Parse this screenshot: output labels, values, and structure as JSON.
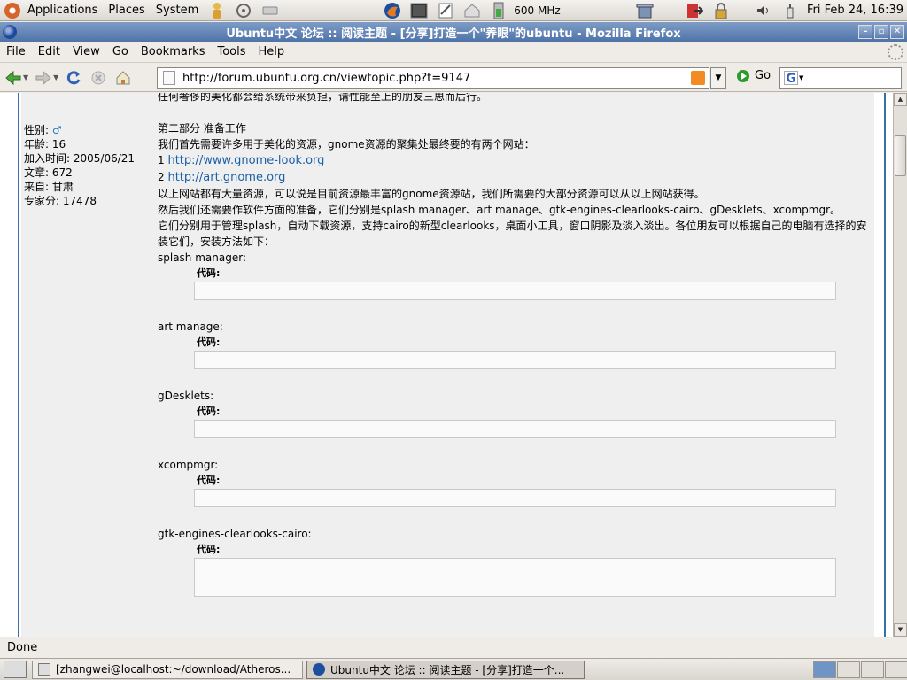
{
  "panel": {
    "menus": [
      "Applications",
      "Places",
      "System"
    ],
    "cpu_freq": "600 MHz",
    "clock": "Fri Feb 24, 16:39"
  },
  "window": {
    "title": "Ubuntu中文 论坛 :: 阅读主题 - [分享]打造一个\"养眼\"的ubuntu - Mozilla Firefox"
  },
  "menubar": {
    "items": [
      "File",
      "Edit",
      "View",
      "Go",
      "Bookmarks",
      "Tools",
      "Help"
    ]
  },
  "navbar": {
    "url": "http://forum.ubuntu.org.cn/viewtopic.php?t=9147",
    "go_label": "Go"
  },
  "user_info": {
    "gender": "性别:",
    "age": "年龄: 16",
    "joined": "加入时间: 2005/06/21",
    "posts": "文章: 672",
    "from": "来自: 甘肃",
    "expert": "专家分: 17478"
  },
  "post": {
    "line0": "任何奢侈的美化都会给系统带来负担，请性能至上的朋友三思而后行。",
    "part2_title": "第二部分 准备工作",
    "line1": "我们首先需要许多用于美化的资源，gnome资源的聚集处最终要的有两个网站：",
    "link1_num": "1",
    "link1": "http://www.gnome-look.org",
    "link2_num": "2",
    "link2": "http://art.gnome.org",
    "line2": "以上网站都有大量资源，可以说是目前资源最丰富的gnome资源站，我们所需要的大部分资源可以从以上网站获得。",
    "line3": "然后我们还需要作软件方面的准备，它们分别是splash manager、art manage、gtk-engines-clearlooks-cairo、gDesklets、xcompmgr。",
    "line4": "它们分别用于管理splash，自动下载资源，支持cairo的新型clearlooks，桌面小工具，窗口阴影及淡入淡出。各位朋友可以根据自己的电脑有选择的安装它们，安装方法如下：",
    "code_label": "代码:",
    "sections": [
      {
        "title": "splash manager:"
      },
      {
        "title": "art manage:"
      },
      {
        "title": "gDesklets:"
      },
      {
        "title": "xcompmgr:"
      },
      {
        "title": "gtk-engines-clearlooks-cairo:"
      }
    ]
  },
  "status": "Done",
  "taskbar": {
    "tasks": [
      "[zhangwei@localhost:~/download/Atheros...",
      "Ubuntu中文 论坛 :: 阅读主题 - [分享]打造一个..."
    ]
  }
}
